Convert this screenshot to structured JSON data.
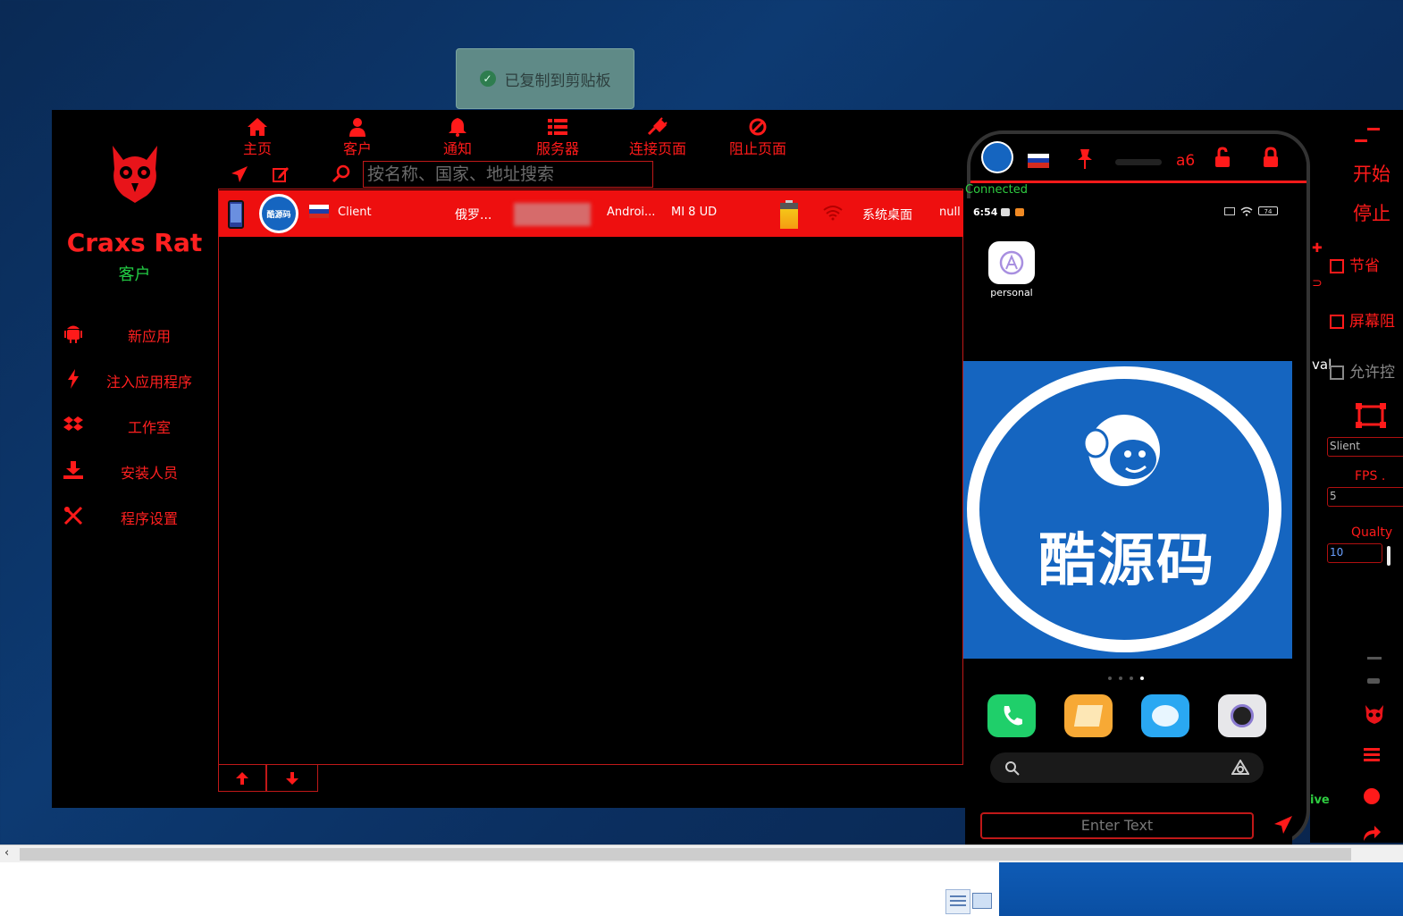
{
  "toast": {
    "message": "已复制到剪贴板"
  },
  "brand": {
    "name": "Craxs Rat",
    "subtitle": "客户"
  },
  "sidebar": {
    "items": [
      {
        "label": "新应用",
        "icon": "android-icon"
      },
      {
        "label": "注入应用程序",
        "icon": "bolt-icon"
      },
      {
        "label": "工作室",
        "icon": "dropbox-icon"
      },
      {
        "label": "安装人员",
        "icon": "download-icon"
      },
      {
        "label": "程序设置",
        "icon": "tools-icon"
      }
    ]
  },
  "nav": {
    "tabs": [
      {
        "label": "主页",
        "icon": "home-icon"
      },
      {
        "label": "客户",
        "icon": "user-icon"
      },
      {
        "label": "通知",
        "icon": "bell-icon"
      },
      {
        "label": "服务器",
        "icon": "server-list-icon"
      },
      {
        "label": "连接页面",
        "icon": "plug-icon"
      },
      {
        "label": "阻止页面",
        "icon": "block-icon"
      }
    ]
  },
  "search": {
    "placeholder": "按名称、国家、地址搜索"
  },
  "client_row": {
    "name": "Client",
    "country": "俄罗...",
    "os": "Androi...",
    "model": "MI 8 UD",
    "activity": "系统桌面",
    "extra": "null",
    "avatar_text": "酷源码"
  },
  "phone": {
    "header_code": "a6",
    "status": "Connected",
    "time": "6:54",
    "battery": "74",
    "app_label": "personal",
    "logo_text": "酷源码",
    "enter_text_placeholder": "Enter Text"
  },
  "right_panel": {
    "start": "开始",
    "stop": "停止",
    "save_label": "节省",
    "screen_block_label": "屏幕阻",
    "allow_control_label": "允许控",
    "mode_value": "Slient",
    "fps_label": "FPS .",
    "fps_value": "5",
    "quality_label": "Qualty",
    "quality_value": "10",
    "left_cut_text": "val",
    "live_cut_text": "ive"
  },
  "colors": {
    "accent": "#ff1a1a",
    "row_bg": "#ee0f0f",
    "connected": "#2ecc40",
    "brand_sub": "#22cc44"
  }
}
